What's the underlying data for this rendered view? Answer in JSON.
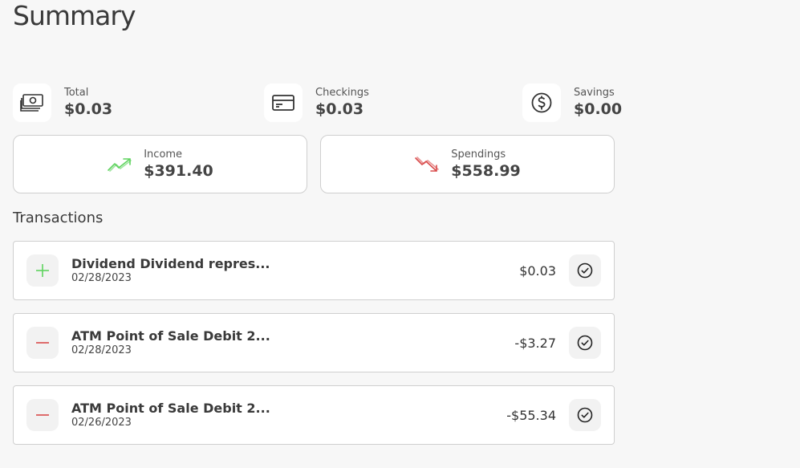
{
  "page": {
    "title": "Summary"
  },
  "balances": [
    {
      "label": "Total",
      "value": "$0.03",
      "icon": "cash-icon"
    },
    {
      "label": "Checkings",
      "value": "$0.03",
      "icon": "credit-card-icon"
    },
    {
      "label": "Savings",
      "value": "$0.00",
      "icon": "dollar-coin-icon"
    }
  ],
  "income": {
    "label": "Income",
    "value": "$391.40",
    "icon": "trending-up-icon",
    "color": "#5fd35f"
  },
  "spendings": {
    "label": "Spendings",
    "value": "$558.99",
    "icon": "trending-down-icon",
    "color": "#d94b4b"
  },
  "transactions": {
    "title": "Transactions",
    "items": [
      {
        "type": "credit",
        "description": "Dividend Dividend repres...",
        "date": "02/28/2023",
        "amount": "$0.03"
      },
      {
        "type": "debit",
        "description": "ATM Point of Sale Debit 2...",
        "date": "02/28/2023",
        "amount": "-$3.27"
      },
      {
        "type": "debit",
        "description": "ATM Point of Sale Debit 2...",
        "date": "02/26/2023",
        "amount": "-$55.34"
      }
    ]
  },
  "colors": {
    "plus": "#5fd35f",
    "minus": "#d94b4b"
  }
}
